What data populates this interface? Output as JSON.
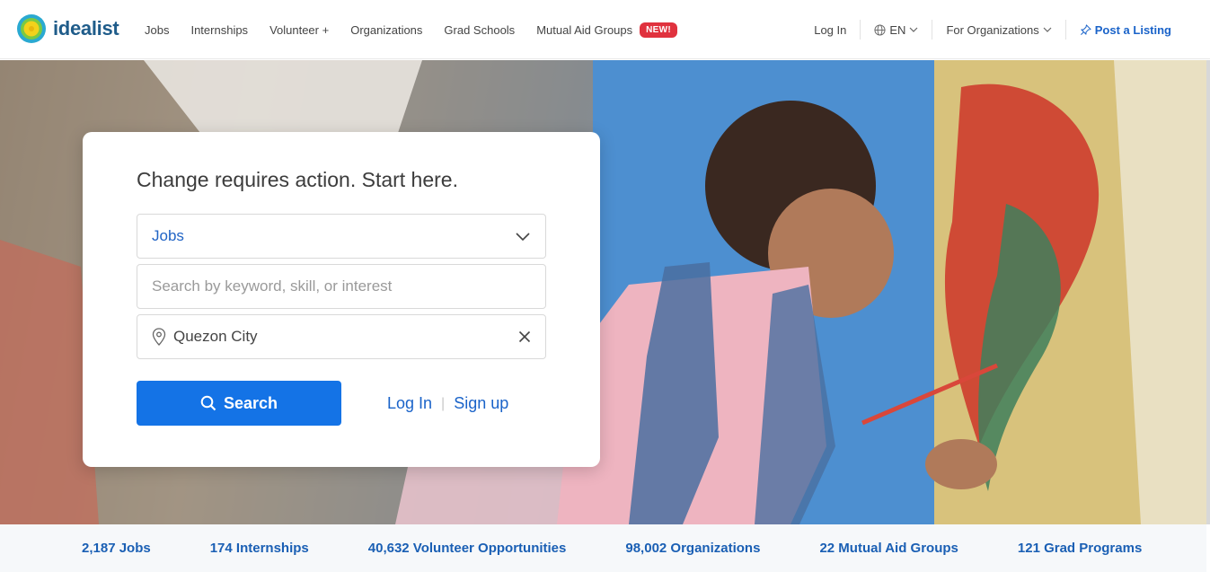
{
  "brand": {
    "name": "idealist"
  },
  "nav": {
    "items": [
      "Jobs",
      "Internships",
      "Volunteer +",
      "Organizations",
      "Grad Schools",
      "Mutual Aid Groups"
    ],
    "badge": "NEW!"
  },
  "right_nav": {
    "login": "Log In",
    "language": "EN",
    "for_orgs": "For Organizations",
    "post": "Post a Listing"
  },
  "hero": {
    "headline": "Change requires action. Start here.",
    "type_select": "Jobs",
    "keyword_placeholder": "Search by keyword, skill, or interest",
    "location_value": "Quezon City",
    "search_label": "Search",
    "login_label": "Log In",
    "divider": "|",
    "signup_label": "Sign up"
  },
  "stats": [
    "2,187 Jobs",
    "174 Internships",
    "40,632 Volunteer Opportunities",
    "98,002 Organizations",
    "22 Mutual Aid Groups",
    "121 Grad Programs"
  ],
  "colors": {
    "accent": "#1473e6",
    "link": "#1a63c9",
    "badge": "#e0323e"
  },
  "icons": [
    "idealist-logo-icon",
    "globe-icon",
    "chevron-down-icon",
    "pin-icon",
    "location-pin-icon",
    "close-icon",
    "search-icon"
  ]
}
